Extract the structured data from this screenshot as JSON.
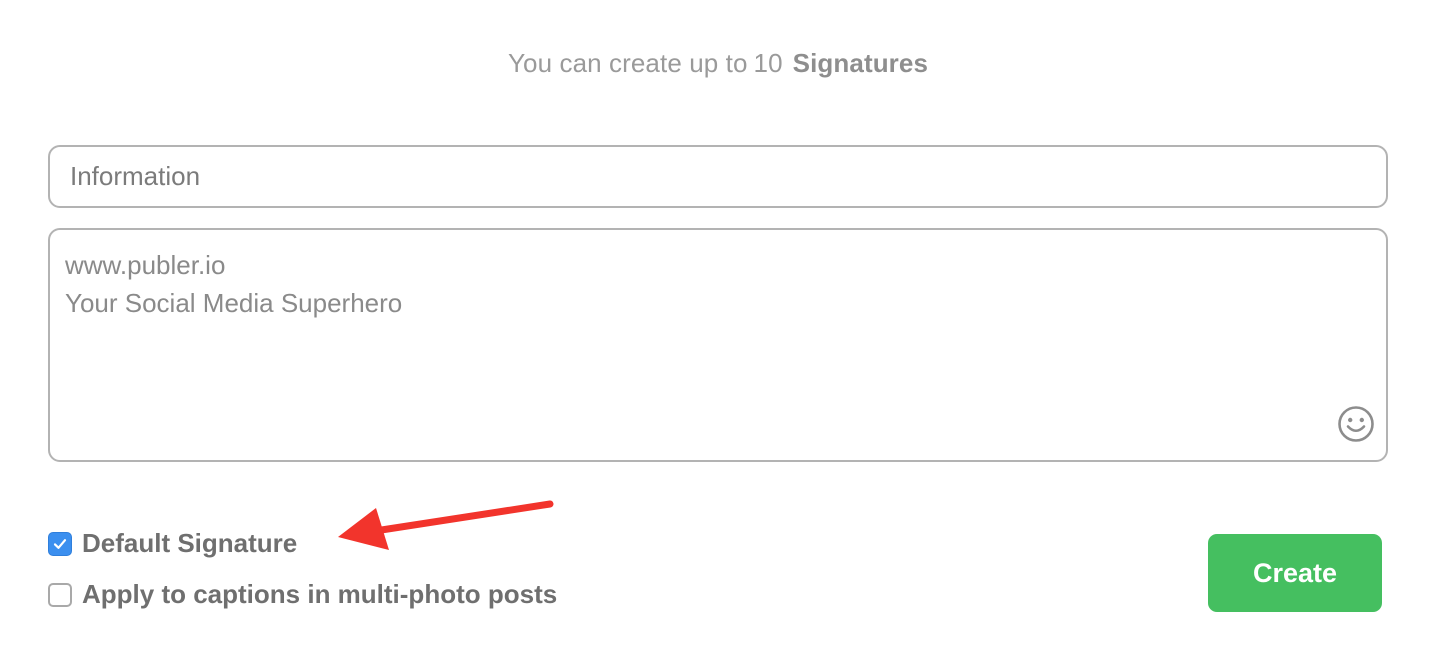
{
  "header": {
    "limit_prefix": "You can create up to",
    "limit_count": "10",
    "limit_suffix": "Signatures"
  },
  "form": {
    "name_value": "Information",
    "signature_lines": [
      "www.publer.io",
      "Your Social Media Superhero"
    ]
  },
  "options": {
    "default_signature_label": "Default Signature",
    "default_signature_checked": true,
    "multi_photo_label": "Apply to captions in multi-photo posts",
    "multi_photo_checked": false
  },
  "actions": {
    "create_label": "Create"
  },
  "colors": {
    "create_button": "#45bf60",
    "checkbox_checked": "#3b8fef",
    "annotation_arrow": "#f2342c"
  },
  "icons": {
    "emoji": "smiley-face-icon",
    "check": "checkmark-icon",
    "annotation": "red-arrow-icon"
  }
}
